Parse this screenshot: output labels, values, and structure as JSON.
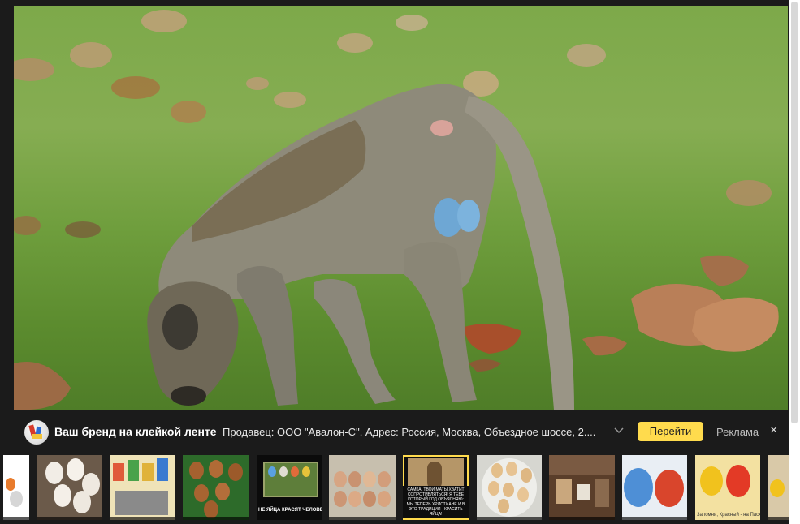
{
  "ad": {
    "brand_title": "Ваш бренд на клейкой ленте",
    "seller_text": "Продавец: ООО \"Авалон-С\". Адрес: Россия, Москва, Объездное шоссе, 2....",
    "go_button": "Перейти",
    "ad_label": "Реклама",
    "close_glyph": "×"
  },
  "photo": {
    "subject": "vervet monkey on grass with blue scrotum"
  },
  "thumbnails": [
    {
      "caption": ""
    },
    {
      "caption": ""
    },
    {
      "caption": ""
    },
    {
      "caption": ""
    },
    {
      "caption": "НЕ ЯЙЦА КРАСЯТ ЧЕЛОВЕКА, А ЧЕЛОВЕК ЯЙЦА"
    },
    {
      "caption": ""
    },
    {
      "caption": "САМКА, ТВОИ МАТЫ ХВАТИТ СОПРОТИВЛЯТЬСЯ! Я ТЕБЕ КОТОРЫЙ ГОД ОБЪЯСНЯЮ: МЫ ТЕПЕРЬ ХРИСТИАНЕ И В ЭТО ТРАДИЦИЯ - КРАСИТЬ ЯЙЦА!"
    },
    {
      "caption": ""
    },
    {
      "caption": ""
    },
    {
      "caption": ""
    },
    {
      "caption": "Запомни, Красный - на Пасху"
    },
    {
      "caption": ""
    }
  ],
  "colors": {
    "accent_button": "#ffdb4d",
    "background": "#1b1b1b",
    "annotation_line": "#d6001c"
  }
}
